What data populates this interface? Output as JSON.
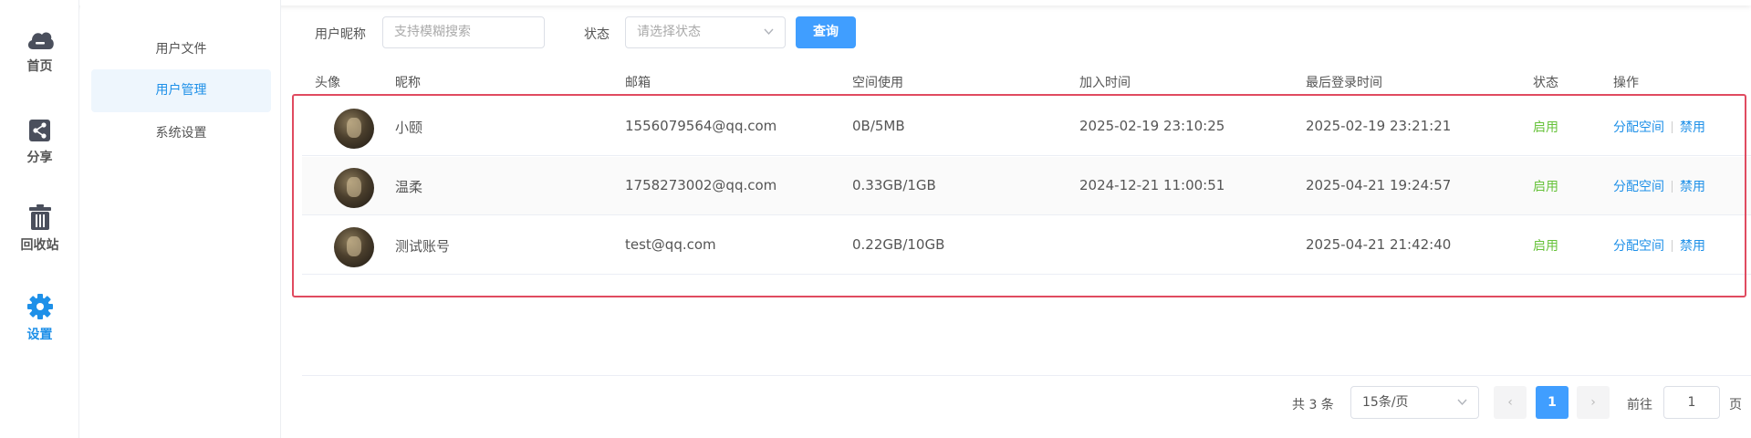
{
  "nav": {
    "items": [
      {
        "label": "首页",
        "icon": "cloud-icon"
      },
      {
        "label": "分享",
        "icon": "share-icon"
      },
      {
        "label": "回收站",
        "icon": "trash-icon"
      },
      {
        "label": "设置",
        "icon": "gear-icon",
        "active": true
      }
    ]
  },
  "subnav": {
    "items": [
      {
        "label": "用户文件"
      },
      {
        "label": "用户管理",
        "active": true
      },
      {
        "label": "系统设置"
      }
    ]
  },
  "filters": {
    "nickname_label": "用户昵称",
    "nickname_placeholder": "支持模糊搜索",
    "status_label": "状态",
    "status_placeholder": "请选择状态",
    "query_button": "查询"
  },
  "table": {
    "columns": [
      "头像",
      "昵称",
      "邮箱",
      "空间使用",
      "加入时间",
      "最后登录时间",
      "状态",
      "操作"
    ],
    "rows": [
      {
        "nickname": "小颐",
        "email": "1556079564@qq.com",
        "space": "0B/5MB",
        "joined": "2025-02-19 23:10:25",
        "last_login": "2025-02-19 23:21:21",
        "status": "启用"
      },
      {
        "nickname": "温柔",
        "email": "1758273002@qq.com",
        "space": "0.33GB/1GB",
        "joined": "2024-12-21 11:00:51",
        "last_login": "2025-04-21 19:24:57",
        "status": "启用"
      },
      {
        "nickname": "测试账号",
        "email": "test@qq.com",
        "space": "0.22GB/10GB",
        "joined": "",
        "last_login": "2025-04-21 21:42:40",
        "status": "启用"
      }
    ],
    "action_allocate": "分配空间",
    "action_disable": "禁用"
  },
  "pagination": {
    "total_text": "共 3 条",
    "page_size": "15条/页",
    "current_page": "1",
    "goto_label": "前往",
    "goto_value": "1",
    "page_suffix": "页",
    "prev_icon": "‹",
    "next_icon": "›"
  },
  "colors": {
    "accent": "#409eff",
    "active_text": "#1e90e8",
    "status_enabled": "#67c23a",
    "highlight_border": "#e04b60"
  }
}
